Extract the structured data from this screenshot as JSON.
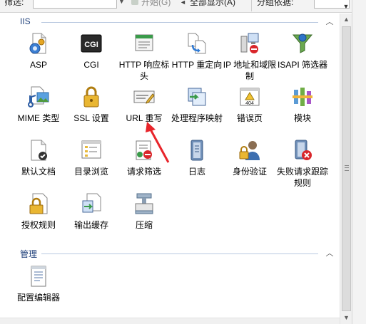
{
  "toolbar": {
    "filter_label": "筛选:",
    "start_label": "开始(G)",
    "show_all_label": "全部显示(A)",
    "group_by_label": "分组依据:"
  },
  "groups": [
    {
      "title": "IIS",
      "items": [
        {
          "label": "ASP",
          "icon": "asp-icon"
        },
        {
          "label": "CGI",
          "icon": "cgi-icon"
        },
        {
          "label": "HTTP 响应标头",
          "icon": "http-response-headers-icon"
        },
        {
          "label": "HTTP 重定向",
          "icon": "http-redirect-icon"
        },
        {
          "label": "IP 地址和域限制",
          "icon": "ip-domain-restrictions-icon"
        },
        {
          "label": "ISAPI 筛选器",
          "icon": "isapi-filters-icon"
        },
        {
          "label": "MIME 类型",
          "icon": "mime-types-icon"
        },
        {
          "label": "SSL 设置",
          "icon": "ssl-settings-icon"
        },
        {
          "label": "URL 重写",
          "icon": "url-rewrite-icon"
        },
        {
          "label": "处理程序映射",
          "icon": "handler-mappings-icon"
        },
        {
          "label": "错误页",
          "icon": "error-pages-icon"
        },
        {
          "label": "模块",
          "icon": "modules-icon"
        },
        {
          "label": "默认文档",
          "icon": "default-document-icon"
        },
        {
          "label": "目录浏览",
          "icon": "directory-browsing-icon"
        },
        {
          "label": "请求筛选",
          "icon": "request-filtering-icon"
        },
        {
          "label": "日志",
          "icon": "logging-icon"
        },
        {
          "label": "身份验证",
          "icon": "authentication-icon"
        },
        {
          "label": "失败请求跟踪规则",
          "icon": "failed-request-tracing-icon"
        },
        {
          "label": "授权规则",
          "icon": "authorization-rules-icon"
        },
        {
          "label": "输出缓存",
          "icon": "output-caching-icon"
        },
        {
          "label": "压缩",
          "icon": "compression-icon"
        }
      ]
    },
    {
      "title": "管理",
      "items": [
        {
          "label": "配置编辑器",
          "icon": "configuration-editor-icon"
        }
      ]
    }
  ],
  "colors": {
    "group_header": "#1e3f7a",
    "annotation_arrow": "#e8252b"
  }
}
